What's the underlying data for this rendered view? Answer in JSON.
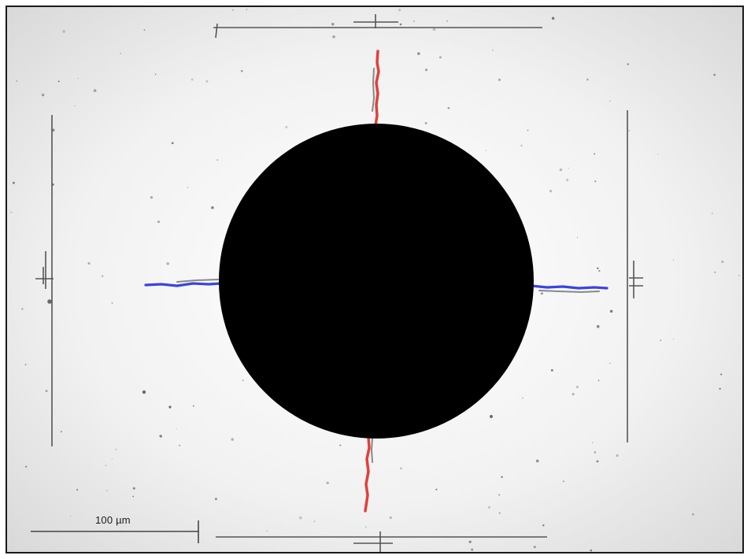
{
  "image": {
    "scale_bar": {
      "label": "100 µm"
    },
    "colors": {
      "background": "#f2f2f2",
      "indent": "#000000",
      "vertical_cracks": "#e0403c",
      "horizontal_cracks": "#3a44e0",
      "measurement_lines": "#555555"
    }
  }
}
